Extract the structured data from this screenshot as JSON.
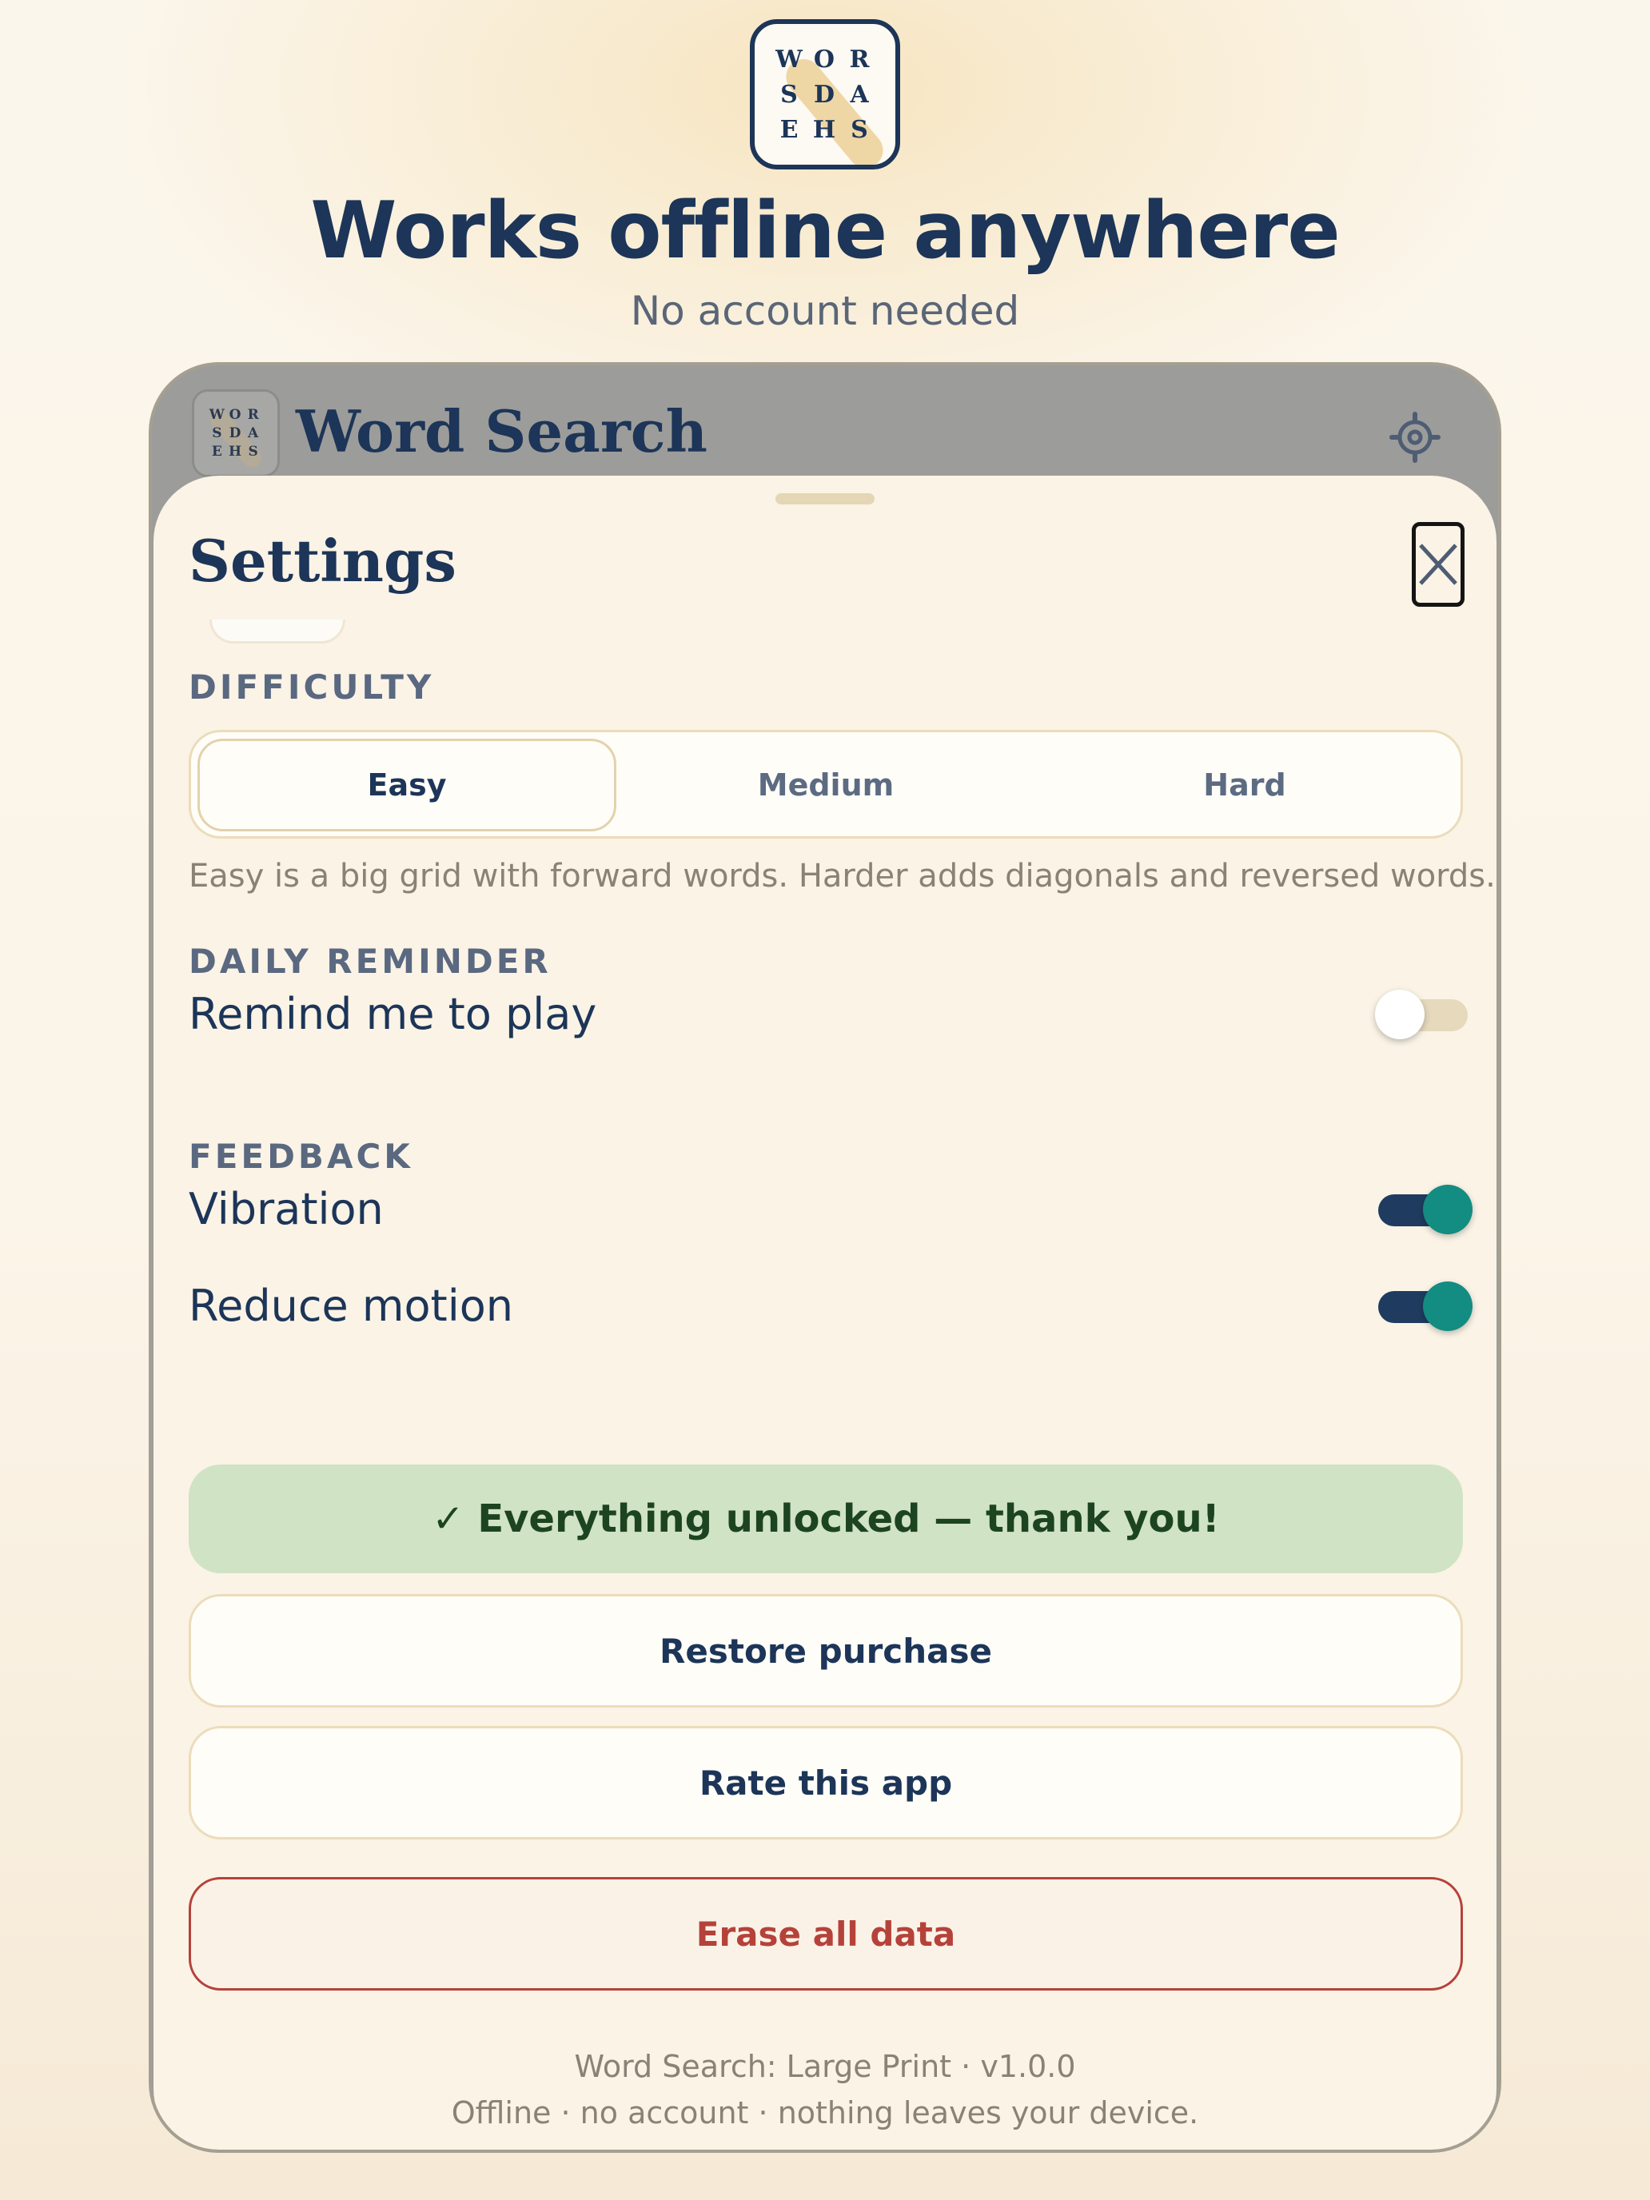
{
  "hero": {
    "logo_letters": [
      "W",
      "O",
      "R",
      "S",
      "D",
      "A",
      "E",
      "H",
      "S"
    ],
    "title": "Works offline anywhere",
    "subtitle": "No account needed"
  },
  "app_header": {
    "title": "Word Search",
    "settings_icon": "gear-icon"
  },
  "settings": {
    "title": "Settings",
    "close_icon": "close-icon",
    "difficulty": {
      "label": "DIFFICULTY",
      "options": [
        "Easy",
        "Medium",
        "Hard"
      ],
      "selected": "Easy",
      "help": "Easy is a big grid with forward words. Harder adds diagonals and reversed words."
    },
    "daily_reminder": {
      "label": "DAILY REMINDER",
      "row": {
        "label": "Remind me to play",
        "on": false
      }
    },
    "feedback": {
      "label": "FEEDBACK",
      "rows": [
        {
          "label": "Vibration",
          "on": true
        },
        {
          "label": "Reduce motion",
          "on": true
        }
      ]
    },
    "unlocked_banner": "✓ Everything unlocked — thank you!",
    "restore_purchase": "Restore purchase",
    "rate_app": "Rate this app",
    "erase_data": "Erase all data",
    "footer": {
      "line1": "Word Search: Large Print · v1.0.0",
      "line2": "Offline · no account · nothing leaves your device."
    }
  },
  "colors": {
    "navy": "#1c3558",
    "teal": "#138c82",
    "success_bg": "#d0e3c5",
    "danger": "#b5423a"
  }
}
